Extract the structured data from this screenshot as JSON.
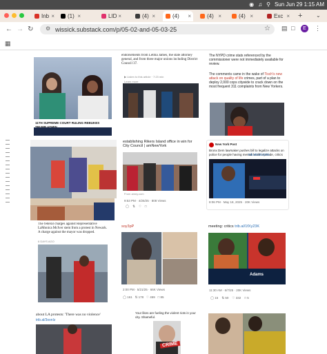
{
  "menubar": {
    "clock": "Sun Jun 29  1:15 AM"
  },
  "tabs": [
    {
      "label": "Inb",
      "color": "#d93025"
    },
    {
      "label": "(1)",
      "color": "#000000"
    },
    {
      "label": "LID",
      "color": "#e1306c"
    },
    {
      "label": "(4)",
      "color": "#3a3a3a"
    },
    {
      "label": "(4)",
      "color": "#ff6719"
    },
    {
      "label": "(4)",
      "color": "#ff6719"
    },
    {
      "label": "(4)",
      "color": "#ff6719"
    },
    {
      "label": "Exc",
      "color": "#b22222"
    }
  ],
  "address": {
    "url": "wissick.substack.com/p/05-02-and-05-03-25",
    "avatar": "E"
  },
  "posts": {
    "c1": {
      "chyron": "11TH SUPREME COURT RULING REBUKES TRUMP ADMIN.",
      "caption1": "The federal charges against Representative LaMonica McIver stem from a protest in Newark. A charge against the mayor was dropped.",
      "byline": "6 DAYS AGO",
      "caption2": "about LA protests: 'There was no violence'",
      "link2": "trib.al/3oxnIz"
    },
    "c2": {
      "text1": "endorsements from Letitia James, the state attorney general, and from three major unions including District Council 37.",
      "listen": "Listen to this article · 7:23 min",
      "learn": "Learn more",
      "text2": "establishing Rikers Island office in win for City Council | amNewYork",
      "from": "From amny.com",
      "meta2": "9:53 PM · 4/25/25 · 808 Views",
      "handle": "soy3pP",
      "meta3": "2:00 PM · 5/21/25 · 66K Views",
      "s_reply": "161",
      "s_rt": "178",
      "s_like": "459",
      "s_book": "85",
      "text4": "Your likes are fueling the violent riots in your city. Shameful."
    },
    "c3": {
      "text1": "The NYPD crime stats referenced by the commissioner were not immediately available for review.",
      "text2a": "The comments came in the wake of ",
      "link2a": "Tisch's new attack on quality of life",
      "text2b": " crimes, part of a plan to deploy 2,000 cops citywide to crack down on the most frequent 311 complaints from New Yorkers.",
      "acct": "New York Post",
      "tweet": "Bronx Dem lawmaker pushes bill to legalize attacks on police for people having mental health episode, critics say",
      "tweet_link": "trib.al/zaG31Ek",
      "meta2": "8:06 PM · May 18, 2025 · 20K Views",
      "text3a": "meeting: critics ",
      "link3": "trib.al/1fXy23K",
      "banner": "Adams",
      "meta3": "11:30 AM · 6/7/25 · 20K Views",
      "s_reply": "15",
      "s_rt": "50",
      "s_like": "332",
      "s_book": "5",
      "overlay": "CRIME"
    }
  }
}
